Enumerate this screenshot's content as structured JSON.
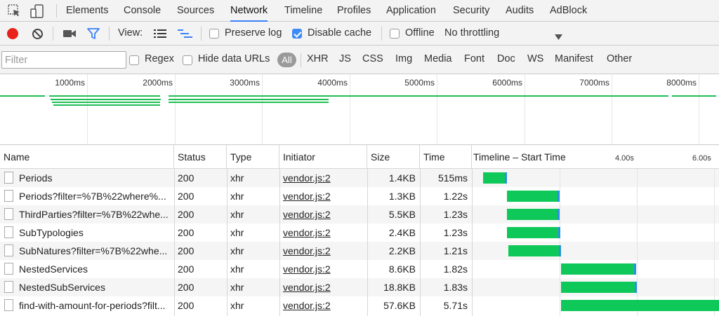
{
  "tabs": [
    "Elements",
    "Console",
    "Sources",
    "Network",
    "Timeline",
    "Profiles",
    "Application",
    "Security",
    "Audits",
    "AdBlock"
  ],
  "active_tab": "Network",
  "toolbar": {
    "view_label": "View:",
    "preserve_log": {
      "label": "Preserve log",
      "checked": false
    },
    "disable_cache": {
      "label": "Disable cache",
      "checked": true
    },
    "offline": {
      "label": "Offline",
      "checked": false
    },
    "throttling": "No throttling"
  },
  "filterbar": {
    "filter_placeholder": "Filter",
    "regex": "Regex",
    "hide_data_urls": "Hide data URLs",
    "all": "All",
    "types": [
      "XHR",
      "JS",
      "CSS",
      "Img",
      "Media",
      "Font",
      "Doc",
      "WS",
      "Manifest",
      "Other"
    ]
  },
  "overview": {
    "ticks": [
      "1000ms",
      "2000ms",
      "3000ms",
      "4000ms",
      "5000ms",
      "6000ms",
      "7000ms",
      "8000ms"
    ]
  },
  "table": {
    "headers": [
      "Name",
      "Status",
      "Type",
      "Initiator",
      "Size",
      "Time",
      "Timeline – Start Time"
    ],
    "timeline_ticks": [
      "4.00s",
      "6.00s"
    ],
    "rows": [
      {
        "name": "Periods",
        "status": "200",
        "type": "xhr",
        "initiator": "vendor.js:2",
        "size": "1.4KB",
        "time": "515ms"
      },
      {
        "name": "Periods?filter=%7B%22where%...",
        "status": "200",
        "type": "xhr",
        "initiator": "vendor.js:2",
        "size": "1.3KB",
        "time": "1.22s"
      },
      {
        "name": "ThirdParties?filter=%7B%22whe...",
        "status": "200",
        "type": "xhr",
        "initiator": "vendor.js:2",
        "size": "5.5KB",
        "time": "1.23s"
      },
      {
        "name": "SubTypologies",
        "status": "200",
        "type": "xhr",
        "initiator": "vendor.js:2",
        "size": "2.4KB",
        "time": "1.23s"
      },
      {
        "name": "SubNatures?filter=%7B%22whe...",
        "status": "200",
        "type": "xhr",
        "initiator": "vendor.js:2",
        "size": "2.2KB",
        "time": "1.21s"
      },
      {
        "name": "NestedServices",
        "status": "200",
        "type": "xhr",
        "initiator": "vendor.js:2",
        "size": "8.6KB",
        "time": "1.82s"
      },
      {
        "name": "NestedSubServices",
        "status": "200",
        "type": "xhr",
        "initiator": "vendor.js:2",
        "size": "18.8KB",
        "time": "1.83s"
      },
      {
        "name": "find-with-amount-for-periods?filt...",
        "status": "200",
        "type": "xhr",
        "initiator": "vendor.js:2",
        "size": "57.6KB",
        "time": "5.71s"
      }
    ]
  },
  "colors": {
    "bar": "#0fc85a",
    "bar_tail": "#2d8fe8",
    "accent": "#3a82f7",
    "record": "#e8211c"
  }
}
